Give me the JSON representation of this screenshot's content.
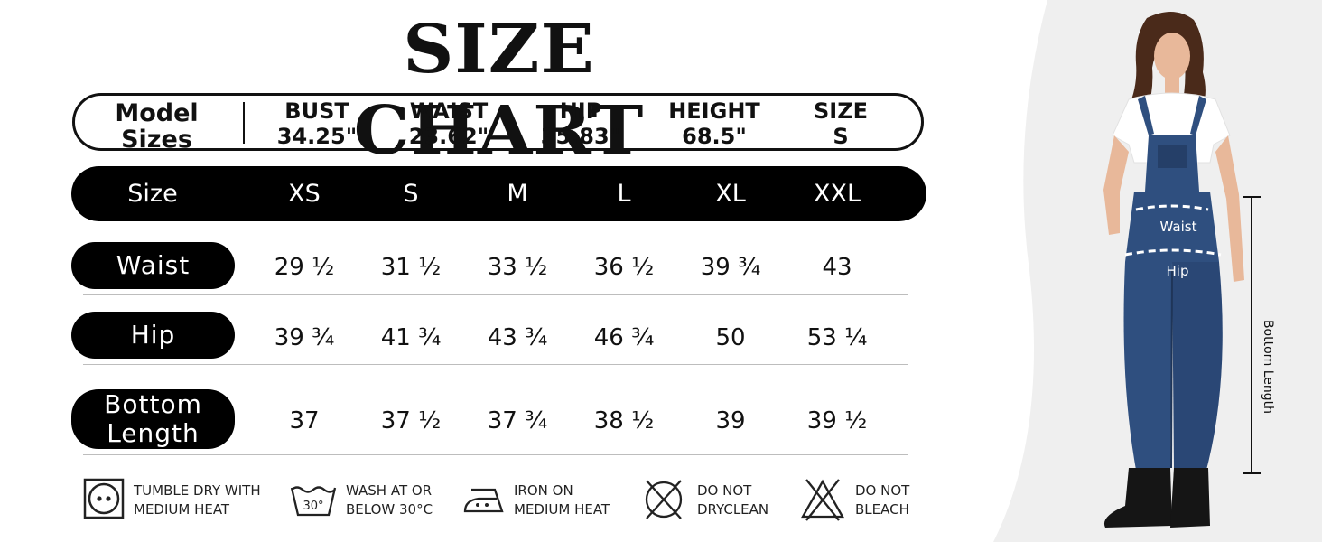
{
  "title": "SIZE CHART",
  "model": {
    "label_line1": "Model",
    "label_line2": "Sizes",
    "items": [
      {
        "name": "BUST",
        "value": "34.25\""
      },
      {
        "name": "WAIST",
        "value": "23.62\""
      },
      {
        "name": "HIP",
        "value": "35.83\""
      },
      {
        "name": "HEIGHT",
        "value": "68.5\""
      },
      {
        "name": "SIZE",
        "value": "S"
      }
    ]
  },
  "size_table": {
    "size_header": "Size",
    "sizes": [
      "XS",
      "S",
      "M",
      "L",
      "XL",
      "XXL"
    ],
    "rows": [
      {
        "label": "Waist",
        "values": [
          "29 ½",
          "31 ½",
          "33 ½",
          "36 ½",
          "39 ¾",
          "43"
        ]
      },
      {
        "label": "Hip",
        "values": [
          "39 ¾",
          "41 ¾",
          "43 ¾",
          "46 ¾",
          "50",
          "53 ¼"
        ]
      },
      {
        "label_line1": "Bottom",
        "label_line2": "Length",
        "values": [
          "37",
          "37 ½",
          "37 ¾",
          "38 ½",
          "39",
          "39 ½"
        ]
      }
    ]
  },
  "care": [
    {
      "icon": "tumble-dry-icon",
      "line1": "TUMBLE DRY WITH",
      "line2": "MEDIUM HEAT"
    },
    {
      "icon": "wash-30-icon",
      "icon_text": "30°",
      "line1": "WASH AT OR",
      "line2": "BELOW 30°C"
    },
    {
      "icon": "iron-icon",
      "line1": "IRON ON",
      "line2": "MEDIUM HEAT"
    },
    {
      "icon": "do-not-dryclean-icon",
      "line1": "DO NOT",
      "line2": "DRYCLEAN"
    },
    {
      "icon": "do-not-bleach-icon",
      "line1": "DO NOT",
      "line2": "BLEACH"
    }
  ],
  "figure": {
    "waist_label": "Waist",
    "hip_label": "Hip",
    "bottom_length_label": "Bottom Length",
    "denim_color": "#2f4f7f",
    "denim_dark": "#1f3558",
    "skin_color": "#e8b89a",
    "hair_color": "#4a2a1a"
  }
}
